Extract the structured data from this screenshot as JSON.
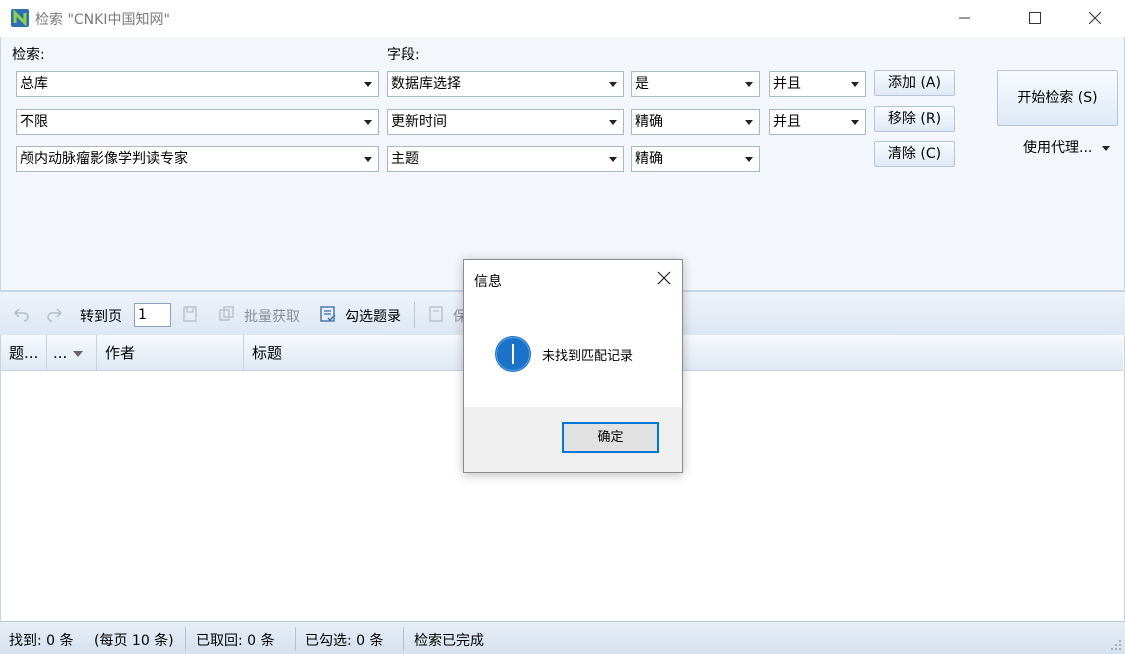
{
  "window": {
    "title": "检索 \"CNKI中国知网\""
  },
  "search": {
    "label": "检索:",
    "field_label": "字段:",
    "rows": [
      {
        "value": "总库",
        "field": "数据库选择",
        "match": "是",
        "logic": "并且"
      },
      {
        "value": "不限",
        "field": "更新时间",
        "match": "精确",
        "logic": "并且"
      },
      {
        "value": "颅内动脉瘤影像学判读专家",
        "field": "主题",
        "match": "精确",
        "logic": ""
      }
    ],
    "add_label": "添加 (A)",
    "remove_label": "移除 (R)",
    "clear_label": "清除 (C)",
    "start_label": "开始检索 (S)",
    "proxy_label": "使用代理..."
  },
  "toolbar": {
    "goto_label": "转到页",
    "page_value": "1",
    "batch_label": "批量获取",
    "select_label": "勾选题录",
    "save_label": "保"
  },
  "grid": {
    "columns": [
      "题...",
      "...",
      "作者",
      "标题"
    ]
  },
  "status": {
    "found": "找到:  0 条",
    "per_page": "(每页 10 条)",
    "retrieved": "已取回:  0 条",
    "checked": "已勾选:  0 条",
    "state": "检索已完成"
  },
  "dialog": {
    "title": "信息",
    "message": "未找到匹配记录",
    "ok_label": "确定"
  },
  "colors": {
    "accent": "#0078d7",
    "info_icon": "#1a73c9",
    "panel_bg": "#f3f7fc"
  }
}
